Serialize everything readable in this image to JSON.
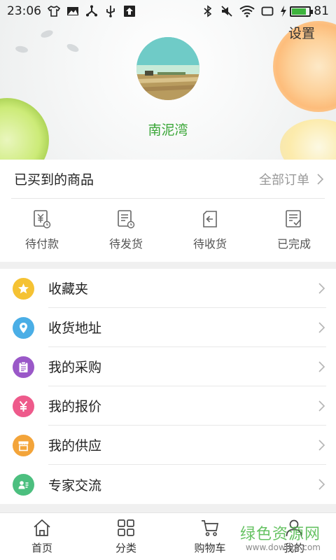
{
  "status_bar": {
    "time": "23:06",
    "battery_level": "81",
    "battery_fraction": 0.81,
    "left_icons": [
      "tshirt-icon",
      "image-icon",
      "share-icon",
      "usb-icon",
      "upload-icon"
    ],
    "right_icons": [
      "bluetooth-icon",
      "mute-icon",
      "wifi-icon",
      "screen-icon",
      "charging-icon"
    ]
  },
  "header": {
    "settings_label": "设置",
    "username": "南泥湾",
    "accent_color": "#3aa637"
  },
  "orders": {
    "title": "已买到的商品",
    "all_orders_label": "全部订单",
    "tabs": [
      {
        "label": "待付款",
        "icon": "yen-receipt-icon"
      },
      {
        "label": "待发货",
        "icon": "list-clock-icon"
      },
      {
        "label": "待收货",
        "icon": "receive-arrow-icon"
      },
      {
        "label": "已完成",
        "icon": "doc-check-icon"
      }
    ]
  },
  "menu": {
    "items": [
      {
        "label": "收藏夹",
        "icon": "star-icon",
        "color": "#f5c233"
      },
      {
        "label": "收货地址",
        "icon": "location-pin-icon",
        "color": "#4aaee6"
      },
      {
        "label": "我的采购",
        "icon": "clipboard-icon",
        "color": "#9a58c8"
      },
      {
        "label": "我的报价",
        "icon": "yen-icon",
        "color": "#ee5a8b"
      },
      {
        "label": "我的供应",
        "icon": "store-icon",
        "color": "#f3a43a"
      },
      {
        "label": "专家交流",
        "icon": "expert-card-icon",
        "color": "#4cbf7f"
      }
    ]
  },
  "bottom_nav": {
    "items": [
      {
        "label": "首页",
        "icon": "home-icon"
      },
      {
        "label": "分类",
        "icon": "grid-icon"
      },
      {
        "label": "购物车",
        "icon": "cart-icon"
      },
      {
        "label": "我的",
        "icon": "user-icon"
      }
    ]
  },
  "watermark": {
    "main": "绿色资源网",
    "sub": "www.downcc.com"
  }
}
